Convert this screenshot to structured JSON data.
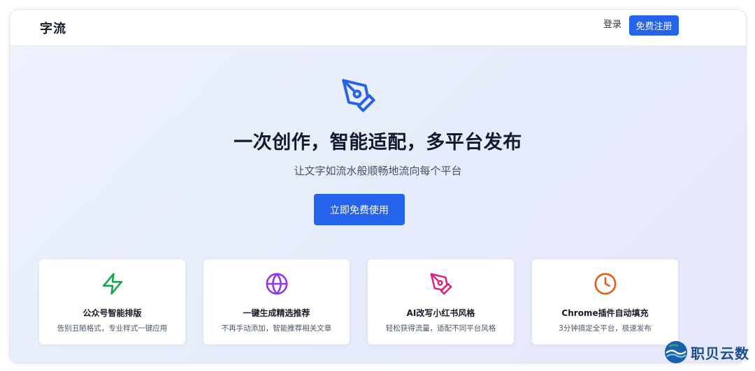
{
  "header": {
    "logo": "字流",
    "login_label": "登录",
    "register_label": "免费注册"
  },
  "hero": {
    "icon": "pen-nib-icon",
    "title": "一次创作，智能适配，多平台发布",
    "subtitle": "让文字如流水般顺畅地流向每个平台",
    "cta_label": "立即免费使用",
    "accent_color": "#2563eb"
  },
  "features": [
    {
      "icon": "lightning-icon",
      "color": "#16a34a",
      "title": "公众号智能排版",
      "desc": "告别丑陋格式，专业样式一键应用"
    },
    {
      "icon": "globe-icon",
      "color": "#9333ea",
      "title": "一键生成精选推荐",
      "desc": "不再手动添加，智能推荐相关文章"
    },
    {
      "icon": "pen-nib-icon",
      "color": "#db2777",
      "title": "AI改写小红书风格",
      "desc": "轻松获得流量，适配不同平台风格"
    },
    {
      "icon": "clock-icon",
      "color": "#ea580c",
      "title": "Chrome插件自动填充",
      "desc": "3分钟搞定全平台，极速发布"
    }
  ],
  "watermark": {
    "text": "职贝云数"
  }
}
